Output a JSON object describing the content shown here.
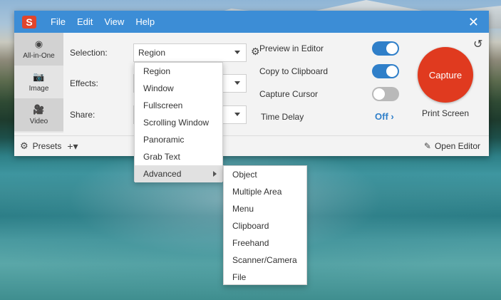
{
  "app": {
    "logo_letter": "S",
    "accent": "#3c8dd6",
    "capture_color": "#e03a1f"
  },
  "menu": [
    "File",
    "Edit",
    "View",
    "Help"
  ],
  "window_controls": {
    "close_icon": "close-icon"
  },
  "sidebar": [
    {
      "label": "All-in-One",
      "icon": "all-in-one-icon",
      "glyph": "◉",
      "active": true
    },
    {
      "label": "Image",
      "icon": "camera-icon",
      "glyph": "📷",
      "active": false
    },
    {
      "label": "Video",
      "icon": "video-icon",
      "glyph": "🎥",
      "active": false
    }
  ],
  "settings": {
    "selection_label": "Selection:",
    "selection_value": "Region",
    "effects_label": "Effects:",
    "share_label": "Share:"
  },
  "options": {
    "preview_in_editor": {
      "label": "Preview in Editor",
      "on": true
    },
    "copy_to_clipboard": {
      "label": "Copy to Clipboard",
      "on": true
    },
    "capture_cursor": {
      "label": "Capture Cursor",
      "on": false
    },
    "time_delay": {
      "label": "Time Delay",
      "value": "Off ›"
    }
  },
  "capture": {
    "button_label": "Capture",
    "shortcut": "Print Screen"
  },
  "bottom": {
    "presets_label": "Presets",
    "add_label": "+▾",
    "open_editor_label": "Open Editor"
  },
  "selection_menu": [
    {
      "label": "Region"
    },
    {
      "label": "Window"
    },
    {
      "label": "Fullscreen"
    },
    {
      "label": "Scrolling Window"
    },
    {
      "label": "Panoramic"
    },
    {
      "label": "Grab Text"
    },
    {
      "label": "Advanced",
      "has_submenu": true,
      "highlighted": true
    }
  ],
  "advanced_submenu": [
    {
      "label": "Object"
    },
    {
      "label": "Multiple Area"
    },
    {
      "label": "Menu"
    },
    {
      "label": "Clipboard"
    },
    {
      "label": "Freehand"
    },
    {
      "label": "Scanner/Camera"
    },
    {
      "label": "File"
    }
  ]
}
